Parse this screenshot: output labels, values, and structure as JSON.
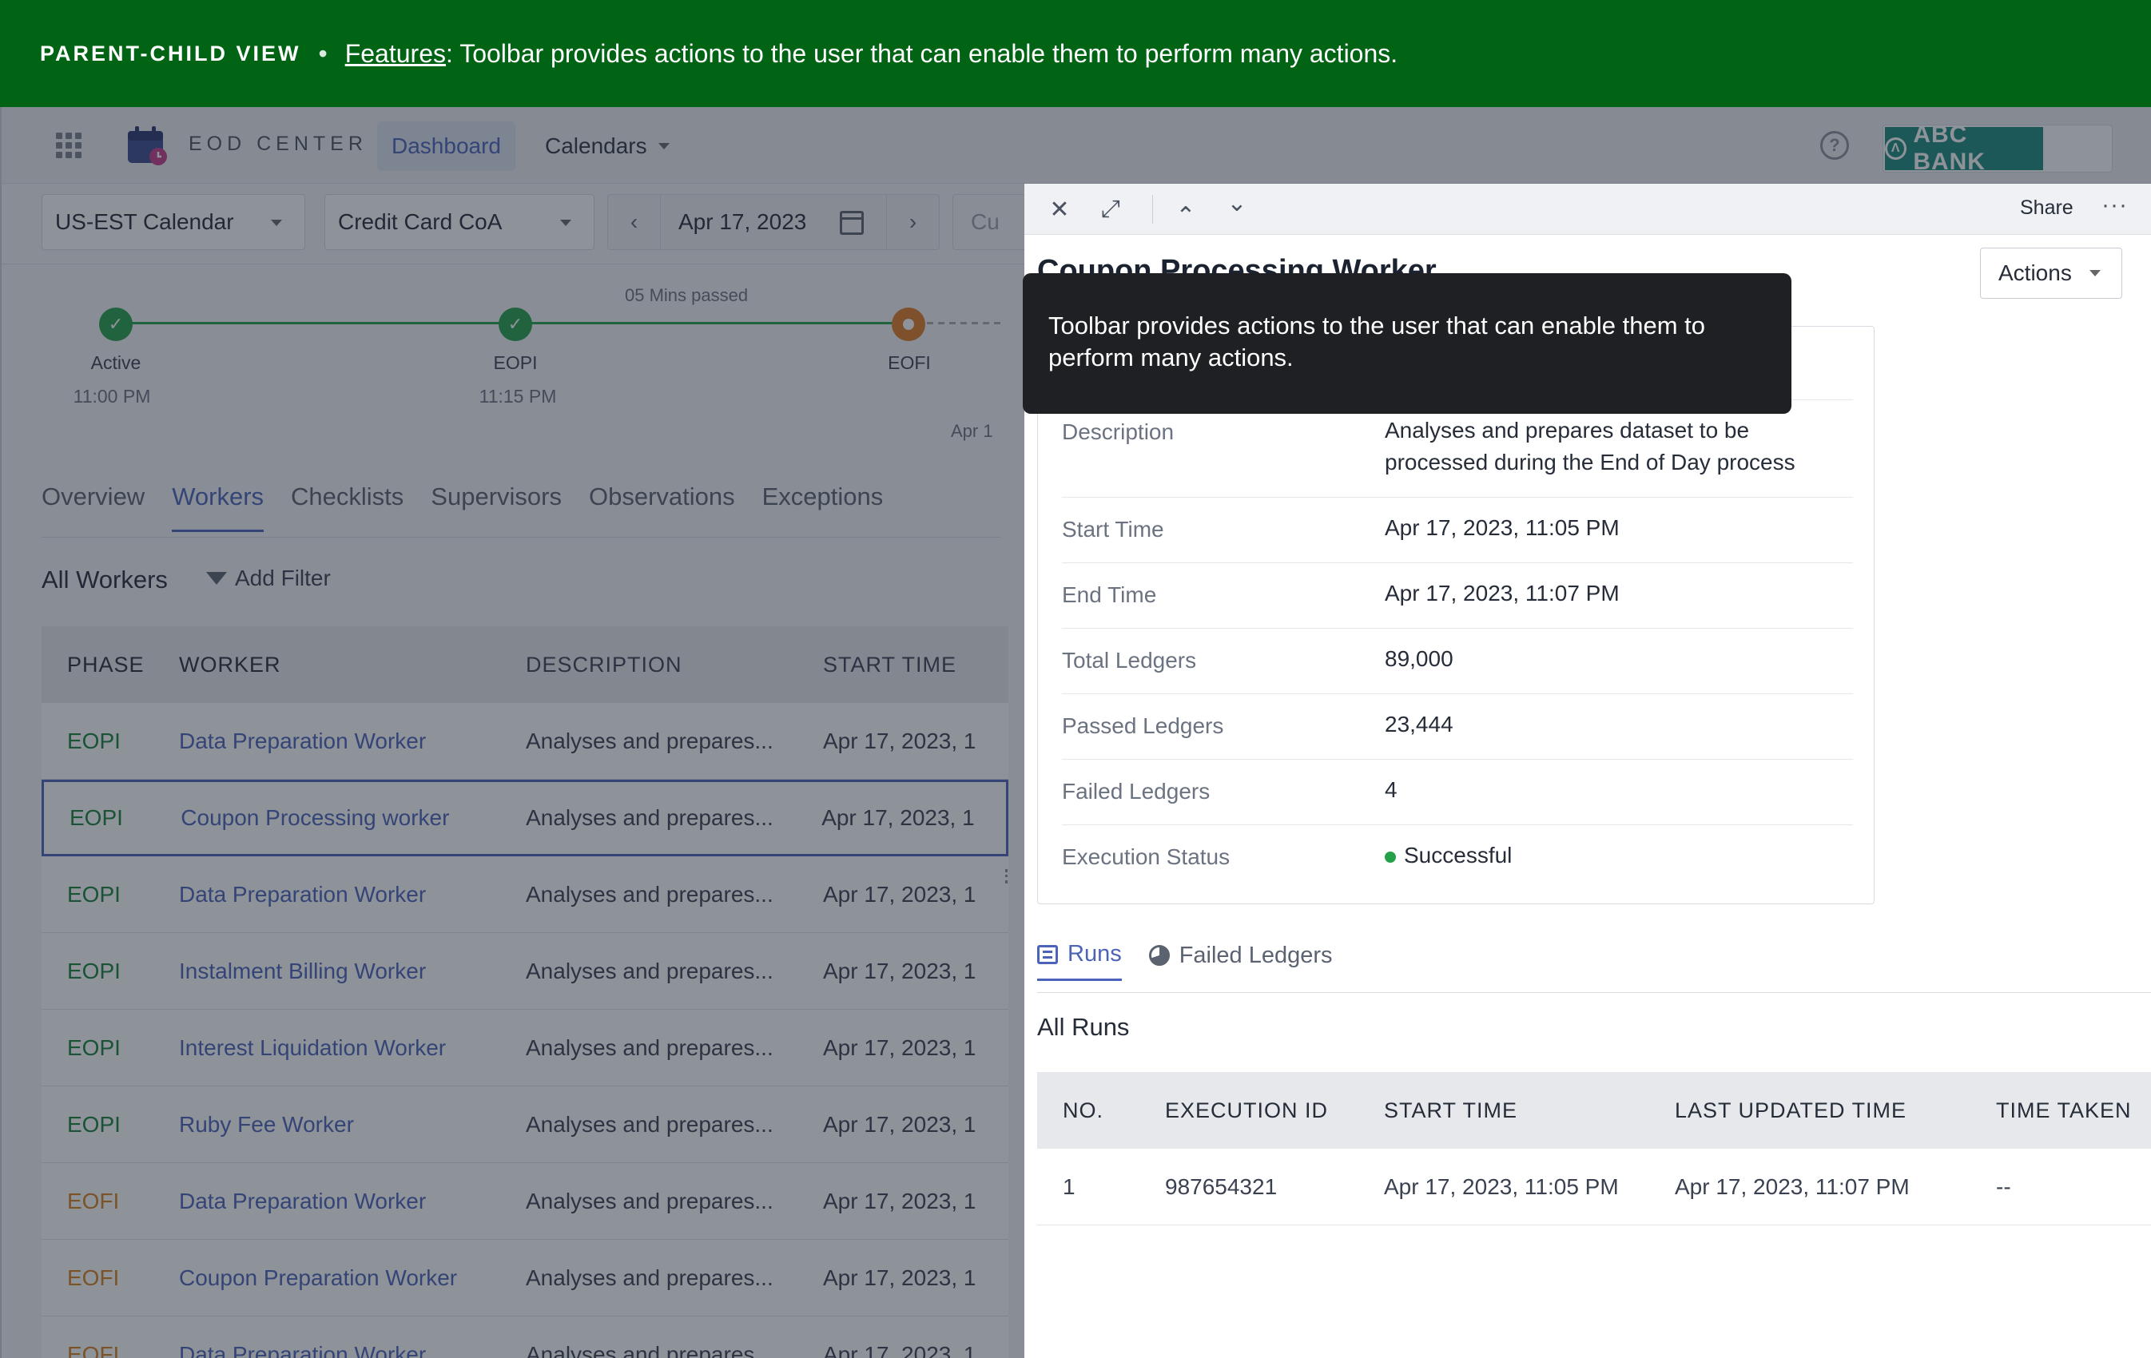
{
  "banner": {
    "tag": "PARENT-CHILD VIEW",
    "separator": "•",
    "link": "Features",
    "text": ": Toolbar provides actions to the user that can enable them to perform many actions."
  },
  "header": {
    "app_name": "EOD CENTER",
    "nav": {
      "dashboard": "Dashboard",
      "calendars": "Calendars"
    },
    "help": "?",
    "bank": "ABC BANK"
  },
  "filters": {
    "calendar": "US-EST Calendar",
    "coa": "Credit Card CoA",
    "date": "Apr 17, 2023",
    "prev": "‹",
    "next": "›",
    "extra": "Cu"
  },
  "timeline": {
    "nodes": [
      {
        "label": "Active",
        "time": "11:00 PM",
        "state": "complete"
      },
      {
        "label": "EOPI",
        "time": "11:15 PM",
        "state": "complete"
      },
      {
        "label": "EOFI",
        "time": "",
        "state": "current"
      }
    ],
    "note": "05 Mins passed",
    "date_hint": "Apr 1"
  },
  "tabs": [
    "Overview",
    "Workers",
    "Checklists",
    "Supervisors",
    "Observations",
    "Exceptions"
  ],
  "active_tab": "Workers",
  "workers": {
    "title": "All Workers",
    "add_filter": "Add Filter",
    "columns": [
      "PHASE",
      "WORKER",
      "DESCRIPTION",
      "START TIME"
    ],
    "rows": [
      {
        "phase": "EOPI",
        "worker": "Data Preparation Worker",
        "desc": "Analyses and prepares...",
        "start": "Apr 17, 2023, 1"
      },
      {
        "phase": "EOPI",
        "worker": "Coupon Processing worker",
        "desc": "Analyses and prepares...",
        "start": "Apr 17, 2023, 1"
      },
      {
        "phase": "EOPI",
        "worker": "Data Preparation Worker",
        "desc": "Analyses and prepares...",
        "start": "Apr 17, 2023, 1"
      },
      {
        "phase": "EOPI",
        "worker": "Instalment Billing Worker",
        "desc": "Analyses and prepares...",
        "start": "Apr 17, 2023, 1"
      },
      {
        "phase": "EOPI",
        "worker": "Interest Liquidation Worker",
        "desc": "Analyses and prepares...",
        "start": "Apr 17, 2023, 1"
      },
      {
        "phase": "EOPI",
        "worker": "Ruby Fee Worker",
        "desc": "Analyses and prepares...",
        "start": "Apr 17, 2023, 1"
      },
      {
        "phase": "EOFI",
        "worker": "Data Preparation Worker",
        "desc": "Analyses and prepares...",
        "start": "Apr 17, 2023, 1"
      },
      {
        "phase": "EOFI",
        "worker": "Coupon Preparation Worker",
        "desc": "Analyses and prepares...",
        "start": "Apr 17, 2023, 1"
      },
      {
        "phase": "EOFI",
        "worker": "Data Preparation Worker",
        "desc": "Analyses and prepares...",
        "start": "Apr 17, 2023, 1"
      }
    ]
  },
  "panel": {
    "toolbar": {
      "close": "✕",
      "expand": "⤢",
      "up": "⌃",
      "down": "⌄",
      "share": "Share",
      "more": "···"
    },
    "title": "Coupon Processing Worker",
    "actions": "Actions",
    "details": [
      {
        "label": "Description",
        "value": "Analyses and prepares dataset to be processed during the End of Day process"
      },
      {
        "label": "Start Time",
        "value": "Apr 17, 2023, 11:05 PM"
      },
      {
        "label": "End Time",
        "value": "Apr 17, 2023, 11:07 PM"
      },
      {
        "label": "Total Ledgers",
        "value": "89,000"
      },
      {
        "label": "Passed Ledgers",
        "value": "23,444"
      },
      {
        "label": "Failed Ledgers",
        "value": "4"
      },
      {
        "label": "Execution Status",
        "value": "Successful"
      }
    ],
    "tabs": [
      "Runs",
      "Failed Ledgers"
    ],
    "runs_title": "All Runs",
    "runs_columns": [
      "NO.",
      "EXECUTION ID",
      "START TIME",
      "LAST UPDATED TIME",
      "TIME TAKEN"
    ],
    "runs_rows": [
      {
        "no": "1",
        "id": "987654321",
        "start": "Apr 17, 2023, 11:05 PM",
        "updated": "Apr 17, 2023, 11:07 PM",
        "taken": "--"
      }
    ]
  },
  "tooltip": {
    "text": "Toolbar provides actions to the user that can enable them to perform many actions."
  },
  "colors": {
    "banner": "#006414",
    "accent": "#4b63b8",
    "success": "#24a148",
    "warning": "#e07b24",
    "eopi": "#198038",
    "eofi": "#d6801f"
  }
}
